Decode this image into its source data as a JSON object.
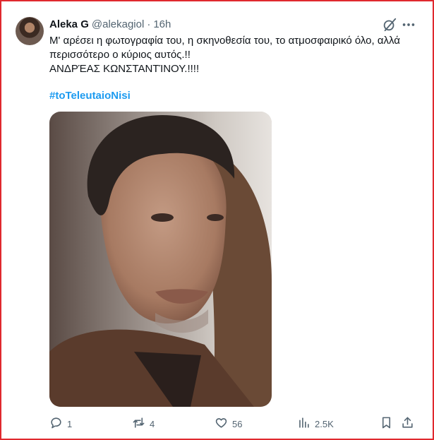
{
  "tweet": {
    "author_name": "Aleka G",
    "handle": "@alekagiol",
    "separator": "·",
    "time": "16h",
    "text_lines": [
      "Μ' αρέσει η φωτογραφία του, η σκηνοθεσία του, το ατμοσφαιρικό όλο, αλλά",
      "περισσότερο ο κύριος αυτός.!!",
      "ΑΝΔΡΈΑΣ ΚΩΝΣΤΑΝΤΊΝΟΥ.!!!!"
    ],
    "hashtag": "#toTeleutaioNisi"
  },
  "actions": {
    "replies": "1",
    "reposts": "4",
    "likes": "56",
    "views": "2.5K"
  },
  "icons": {
    "header": [
      "grok-icon",
      "more-icon"
    ],
    "actions": [
      "reply-icon",
      "repost-icon",
      "like-icon",
      "views-icon",
      "bookmark-icon",
      "share-icon"
    ]
  },
  "colors": {
    "text": "#0f1419",
    "secondary": "#536471",
    "link": "#1d9bf0",
    "frame": "#e0282e"
  }
}
